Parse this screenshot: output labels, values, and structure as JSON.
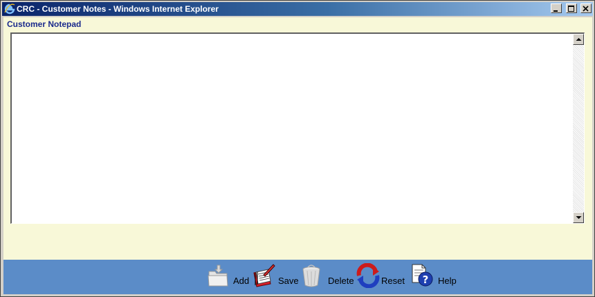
{
  "window": {
    "title": "CRC - Customer Notes - Windows Internet Explorer",
    "controls": [
      "minimize-icon",
      "maximize-icon",
      "close-icon"
    ]
  },
  "page": {
    "heading": "Customer Notepad",
    "notes_value": ""
  },
  "toolbar": {
    "add_label": "Add",
    "save_label": "Save",
    "delete_label": "Delete",
    "reset_label": "Reset",
    "help_label": "Help"
  },
  "colors": {
    "titlebar": "#0a246a",
    "client_background": "#f8f8d8",
    "toolbar_background": "#5b8cc8",
    "heading_text": "#1a2a8c"
  },
  "icons": {
    "ie": "internet-explorer-icon",
    "add": "folder-add-icon",
    "save": "save-notepad-icon",
    "delete": "trash-can-icon",
    "reset": "refresh-arrows-icon",
    "help": "help-document-icon"
  }
}
